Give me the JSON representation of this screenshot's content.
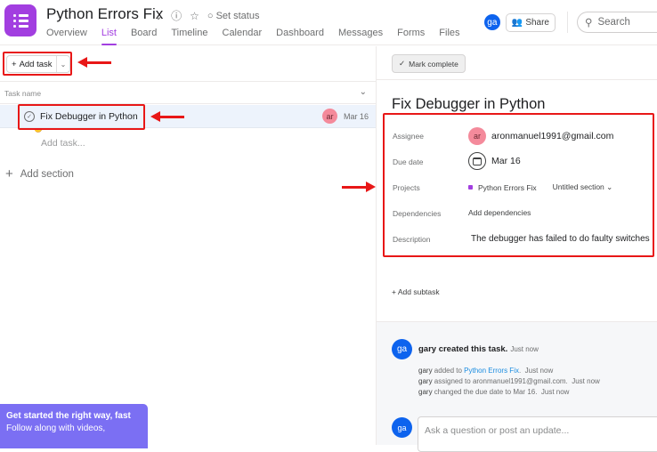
{
  "header": {
    "project_title": "Python Errors Fix",
    "set_status": "Set status",
    "tabs": [
      "Overview",
      "List",
      "Board",
      "Timeline",
      "Calendar",
      "Dashboard",
      "Messages",
      "Forms",
      "Files"
    ],
    "active_tab": "List",
    "user_initials": "ga",
    "share_label": "Share",
    "search_placeholder": "Search"
  },
  "list": {
    "add_task_label": "Add task",
    "column_task_name": "Task name",
    "tasks": [
      {
        "name": "Fix Debugger in Python",
        "assignee_initials": "ar",
        "due": "Mar 16"
      }
    ],
    "add_task_inline": "Add task...",
    "add_section": "Add section"
  },
  "promo": {
    "heading": "Get started the right way, fast",
    "subtext": "Follow along with videos,"
  },
  "detail": {
    "mark_complete": "Mark complete",
    "title": "Fix Debugger in Python",
    "fields": {
      "assignee_label": "Assignee",
      "assignee_initials": "ar",
      "assignee_value": "aronmanuel1991@gmail.com",
      "due_label": "Due date",
      "due_value": "Mar 16",
      "projects_label": "Projects",
      "project_name": "Python Errors Fix",
      "project_section": "Untitled section",
      "dependencies_label": "Dependencies",
      "dependencies_value": "Add dependencies",
      "description_label": "Description",
      "description_value": "The debugger has failed to do faulty switches"
    },
    "add_subtask": "Add subtask",
    "activity": {
      "avatar": "ga",
      "main": "gary created this task.",
      "main_time": "Just now",
      "lines": [
        {
          "user": "gary",
          "text": "added to",
          "link": "Python Errors Fix",
          "suffix": ".",
          "time": "Just now"
        },
        {
          "user": "gary",
          "text": "assigned to aronmanuel1991@gmail.com.",
          "time": "Just now"
        },
        {
          "user": "gary",
          "text": "changed the due date to Mar 16.",
          "time": "Just now"
        }
      ]
    },
    "comment_placeholder": "Ask a question or post an update..."
  }
}
